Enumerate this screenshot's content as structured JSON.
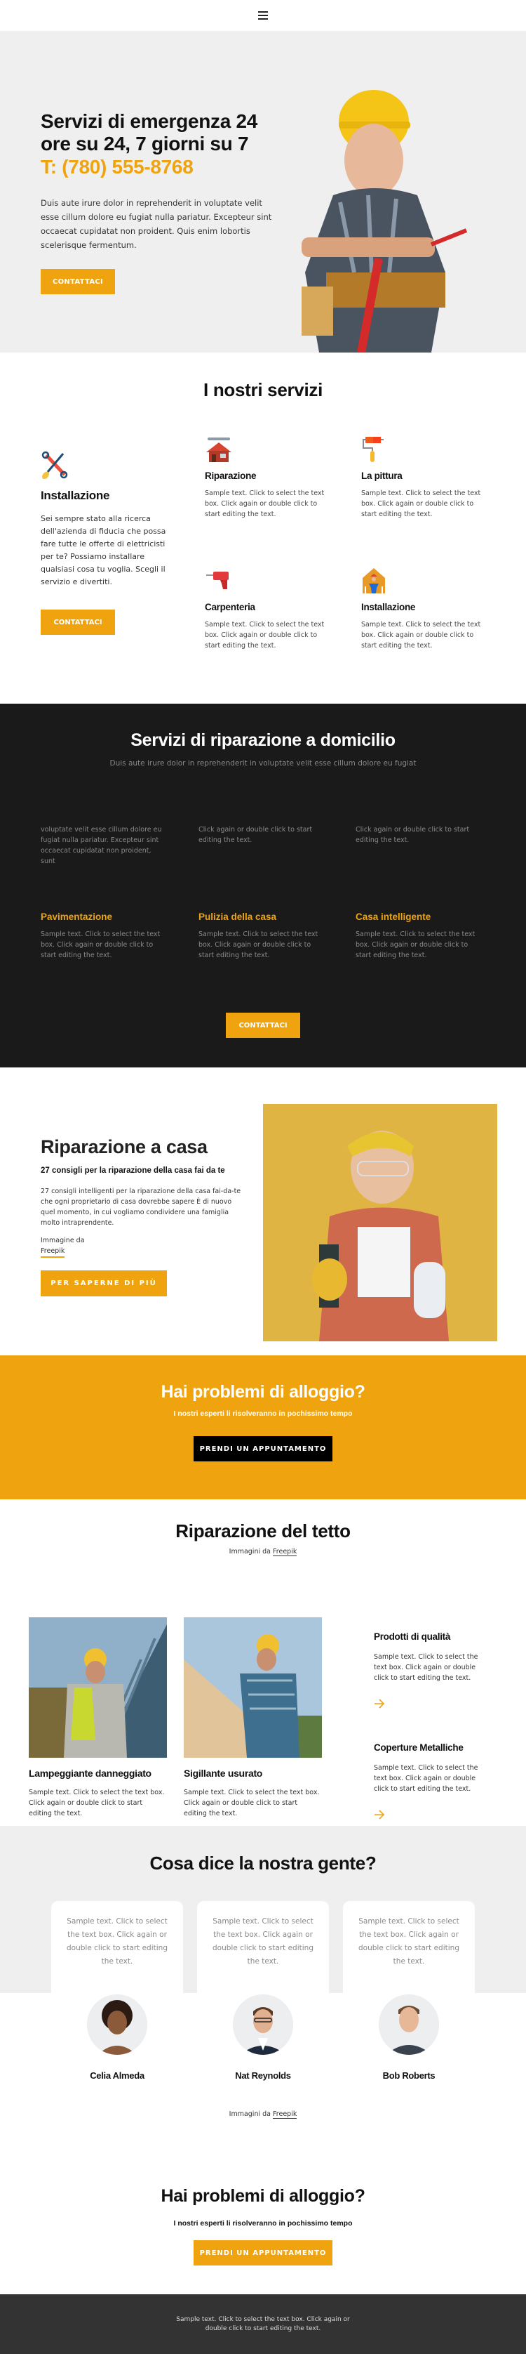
{
  "header": {
    "menu_icon": "hamburger-menu-icon"
  },
  "hero": {
    "title": "Servizi di emergenza 24 ore su 24, 7 giorni su 7",
    "phone": "T: (780) 555-8768",
    "description": "Duis aute irure dolor in reprehenderit in voluptate velit esse cillum dolore eu fugiat nulla pariatur. Excepteur sint occaecat cupidatat non proident. Quis enim lobortis scelerisque fermentum.",
    "button": "Contattaci",
    "image": "worker-with-hard-hat-photo"
  },
  "services": {
    "title": "I nostri servizi",
    "main": {
      "icon": "tools-crossed-icon",
      "title": "Installazione",
      "description": "Sei sempre stato alla ricerca dell'azienda di fiducia che possa fare tutte le offerte di elettricisti per te? Possiamo installare qualsiasi cosa tu voglia. Scegli il servizio e divertiti.",
      "button": "Contattaci"
    },
    "items": [
      {
        "icon": "house-repair-icon",
        "title": "Riparazione",
        "description": "Sample text. Click to select the text box. Click again or double click to start editing the text."
      },
      {
        "icon": "paint-roller-icon",
        "title": "La pittura",
        "description": "Sample text. Click to select the text box. Click again or double click to start editing the text."
      },
      {
        "icon": "drill-icon",
        "title": "Carpenteria",
        "description": "Sample text. Click to select the text box. Click again or double click to start editing the text."
      },
      {
        "icon": "worker-house-icon",
        "title": "Installazione",
        "description": "Sample text. Click to select the text box. Click again or double click to start editing the text."
      }
    ]
  },
  "home_services": {
    "title": "Servizi di riparazione a domicilio",
    "subtitle": "Duis aute irure dolor in reprehenderit in voluptate velit esse cillum dolore eu fugiat",
    "top_row": [
      {
        "text": "voluptate velit esse cillum dolore eu fugiat nulla pariatur. Excepteur sint occaecat cupidatat non proident, sunt"
      },
      {
        "text": "Click again or double click to start editing the text."
      },
      {
        "text": "Click again or double click to start editing the text."
      }
    ],
    "items": [
      {
        "title": "Pavimentazione",
        "description": "Sample text. Click to select the text box. Click again or double click to start editing the text."
      },
      {
        "title": "Pulizia della casa",
        "description": "Sample text. Click to select the text box. Click again or double click to start editing the text."
      },
      {
        "title": "Casa intelligente",
        "description": "Sample text. Click to select the text box. Click again or double click to start editing the text."
      }
    ],
    "button": "Contattaci"
  },
  "home_repair": {
    "title": "Riparazione a casa",
    "subtitle": "27 consigli per la riparazione della casa fai da te",
    "description": "27 consigli intelligenti per la riparazione della casa fai-da-te che ogni proprietario di casa dovrebbe sapere È di nuovo quel momento, in cui vogliamo condividere una famiglia molto intraprendente.",
    "credit_prefix": "Immagine da",
    "credit_link": "Freepik",
    "button": "Per saperne di più",
    "image": "woman-with-drill-photo"
  },
  "cta_yellow": {
    "title": "Hai problemi di alloggio?",
    "subtitle": "I nostri esperti li risolveranno in pochissimo tempo",
    "button": "Prendi un appuntamento"
  },
  "roof": {
    "title": "Riparazione del tetto",
    "credit_prefix": "Immagini da",
    "credit_link": "Freepik",
    "cards": [
      {
        "image": "roofer-metal-roof-photo",
        "title": "Lampeggiante danneggiato",
        "description": "Sample text. Click to select the text box. Click again or double click to start editing the text."
      },
      {
        "image": "roofer-wood-roof-photo",
        "title": "Sigillante usurato",
        "description": "Sample text. Click to select the text box. Click again or double click to start editing the text."
      }
    ],
    "side": [
      {
        "title": "Prodotti di qualità",
        "description": "Sample text. Click to select the text box. Click again or double click to start editing the text."
      },
      {
        "title": "Coperture Metalliche",
        "description": "Sample text. Click to select the text box. Click again or double click to start editing the text."
      }
    ]
  },
  "testimonials": {
    "title": "Cosa dice la nostra gente?",
    "items": [
      {
        "quote": "Sample text. Click to select the text box. Click again or double click to start editing the text.",
        "name": "Celia Almeda"
      },
      {
        "quote": "Sample text. Click to select the text box. Click again or double click to start editing the text.",
        "name": "Nat Reynolds"
      },
      {
        "quote": "Sample text. Click to select the text box. Click again or double click to start editing the text.",
        "name": "Bob Roberts"
      }
    ],
    "credit_prefix": "Immagini da",
    "credit_link": "Freepik"
  },
  "cta_white": {
    "title": "Hai problemi di alloggio?",
    "subtitle": "I nostri esperti li risolveranno in pochissimo tempo",
    "button": "Prendi un appuntamento"
  },
  "footer": {
    "text": "Sample text. Click to select the text box. Click again or double click to start editing the text."
  },
  "colors": {
    "accent": "#efa30f",
    "dark_bg": "#1a1a1a",
    "light_bg": "#efefef",
    "footer_bg": "#333333"
  }
}
